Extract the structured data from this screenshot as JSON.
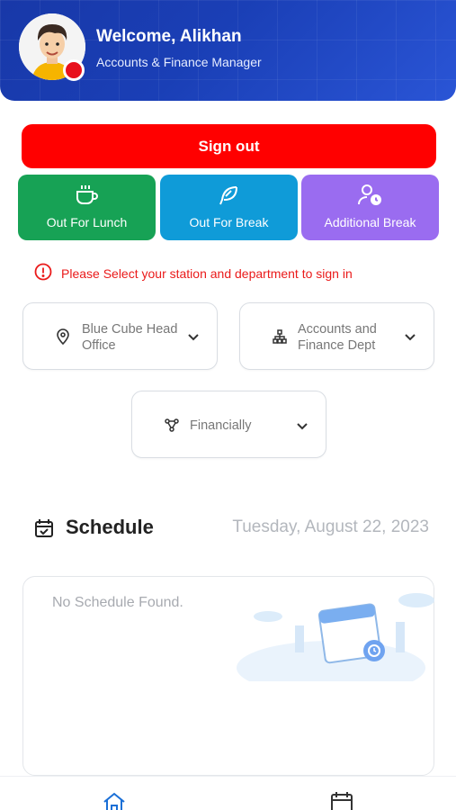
{
  "header": {
    "welcome": "Welcome, Alikhan",
    "role": "Accounts & Finance Manager",
    "avatar_icon": "user-avatar",
    "status": "offline"
  },
  "actions": {
    "sign_out": "Sign out",
    "lunch": "Out For Lunch",
    "lunch_icon": "coffee-icon",
    "break": "Out For Break",
    "break_icon": "feather-icon",
    "additional": "Additional Break",
    "additional_icon": "user-clock-icon"
  },
  "warning": {
    "text": "Please Select your station and department to sign in",
    "icon": "info-icon"
  },
  "selectors": {
    "station": "Blue Cube Head Office",
    "department": "Accounts and Finance Dept",
    "category": "Financially"
  },
  "schedule": {
    "title": "Schedule",
    "date": "Tuesday, August 22, 2023",
    "empty": "No Schedule Found."
  },
  "nav": {
    "home_icon": "home-icon",
    "calendar_icon": "calendar-icon"
  },
  "colors": {
    "header": "#1a3fb6",
    "sign_out": "#ff0000",
    "lunch": "#17a255",
    "break": "#0f9bd8",
    "additional": "#9a6cf0",
    "warning": "#ea1a1a"
  }
}
